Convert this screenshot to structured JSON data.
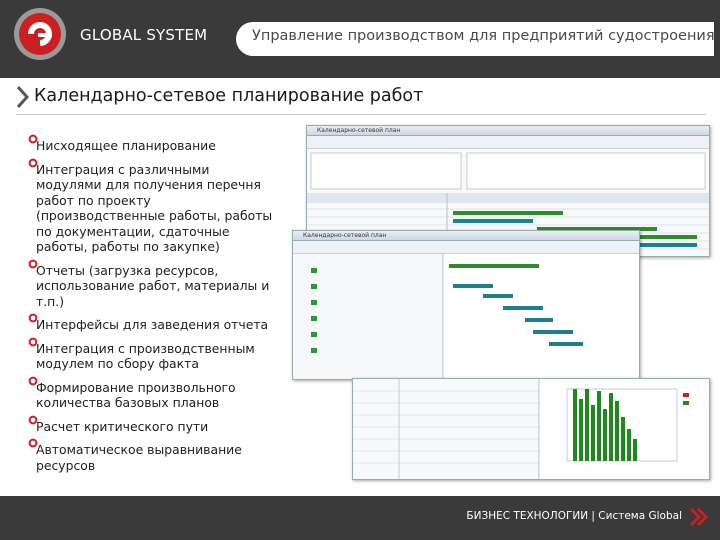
{
  "header": {
    "brand": "GLOBAL SYSTEM",
    "tagline": "Управление производством для предприятий судостроения",
    "logo_text": "GLOBAL SYSTEM"
  },
  "page": {
    "title": "Календарно-сетевое планирование работ"
  },
  "bullets": [
    "Нисходящее планирование",
    "Интеграция с различными модулями для получения перечня работ по проекту (производственные работы, работы по документации, сдаточные работы, работы по закупке)",
    "Отчеты (загрузка ресурсов, использование работ, материалы и т.п.)",
    "Интерфейсы для заведения отчета",
    "Интеграция с производственным модулем по сбору факта",
    "Формирование произвольного количества базовых планов",
    "Расчет критического пути",
    "Автоматическое выравнивание ресурсов"
  ],
  "screens": {
    "gantt_main_title": "Календарно-сетевой план",
    "gantt_sub_title": "Календарно-сетевой план"
  },
  "footer": {
    "text": "БИЗНЕС ТЕХНОЛОГИИ | Система Global"
  },
  "colors": {
    "header_bg": "#3a3a3a",
    "accent_red": "#cc1f1f",
    "gantt_green": "#2e8b2e",
    "gantt_teal": "#1f7f8f"
  }
}
